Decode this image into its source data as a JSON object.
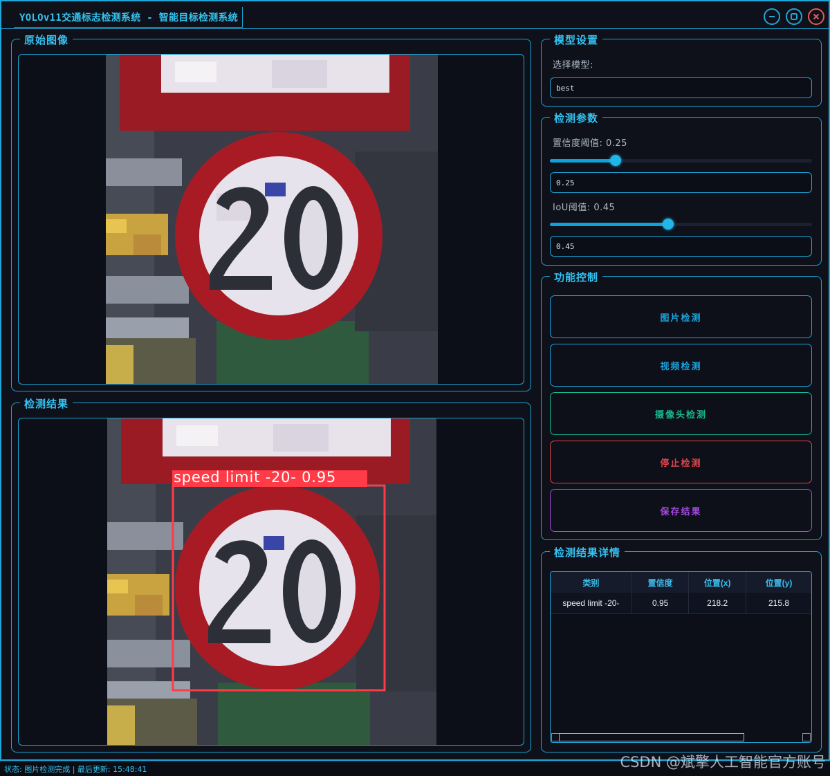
{
  "window": {
    "title": "YOLOv11交通标志检测系统 - 智能目标检测系统",
    "controls": [
      "minimize-icon",
      "maximize-icon",
      "close-icon"
    ]
  },
  "original_panel": {
    "title": "原始图像"
  },
  "result_panel": {
    "title": "检测结果",
    "detection_label": "speed limit -20- 0.95",
    "box_color": "#ff3b47"
  },
  "model_settings": {
    "title": "模型设置",
    "select_label": "选择模型:",
    "selected_model": "best"
  },
  "detection_params": {
    "title": "检测参数",
    "confidence_label": "置信度阈值: 0.25",
    "confidence_value": "0.25",
    "confidence_level": 0.25,
    "iou_label": "IoU阈值: 0.45",
    "iou_value": "0.45",
    "iou_level": 0.45
  },
  "controls": {
    "title": "功能控制",
    "buttons": [
      {
        "label": "图片检测",
        "color": "#1aa4dc"
      },
      {
        "label": "视频检测",
        "color": "#1aa4dc"
      },
      {
        "label": "摄像头检测",
        "color": "#17b890"
      },
      {
        "label": "停止检测",
        "color": "#e0434a"
      },
      {
        "label": "保存结果",
        "color": "#a44ae0"
      }
    ]
  },
  "results_table": {
    "title": "检测结果详情",
    "columns": [
      "类别",
      "置信度",
      "位置(x)",
      "位置(y)"
    ],
    "rows": [
      [
        "speed limit -20-",
        "0.95",
        "218.2",
        "215.8"
      ]
    ]
  },
  "status_bar": {
    "text": "状态: 图片检测完成 | 最后更新: 15:48:41"
  },
  "watermark": "CSDN @斌擎人工智能官方账号",
  "colors": {
    "accent": "#1da6d8",
    "background": "#0e1119",
    "title_text": "#35c2f2"
  }
}
